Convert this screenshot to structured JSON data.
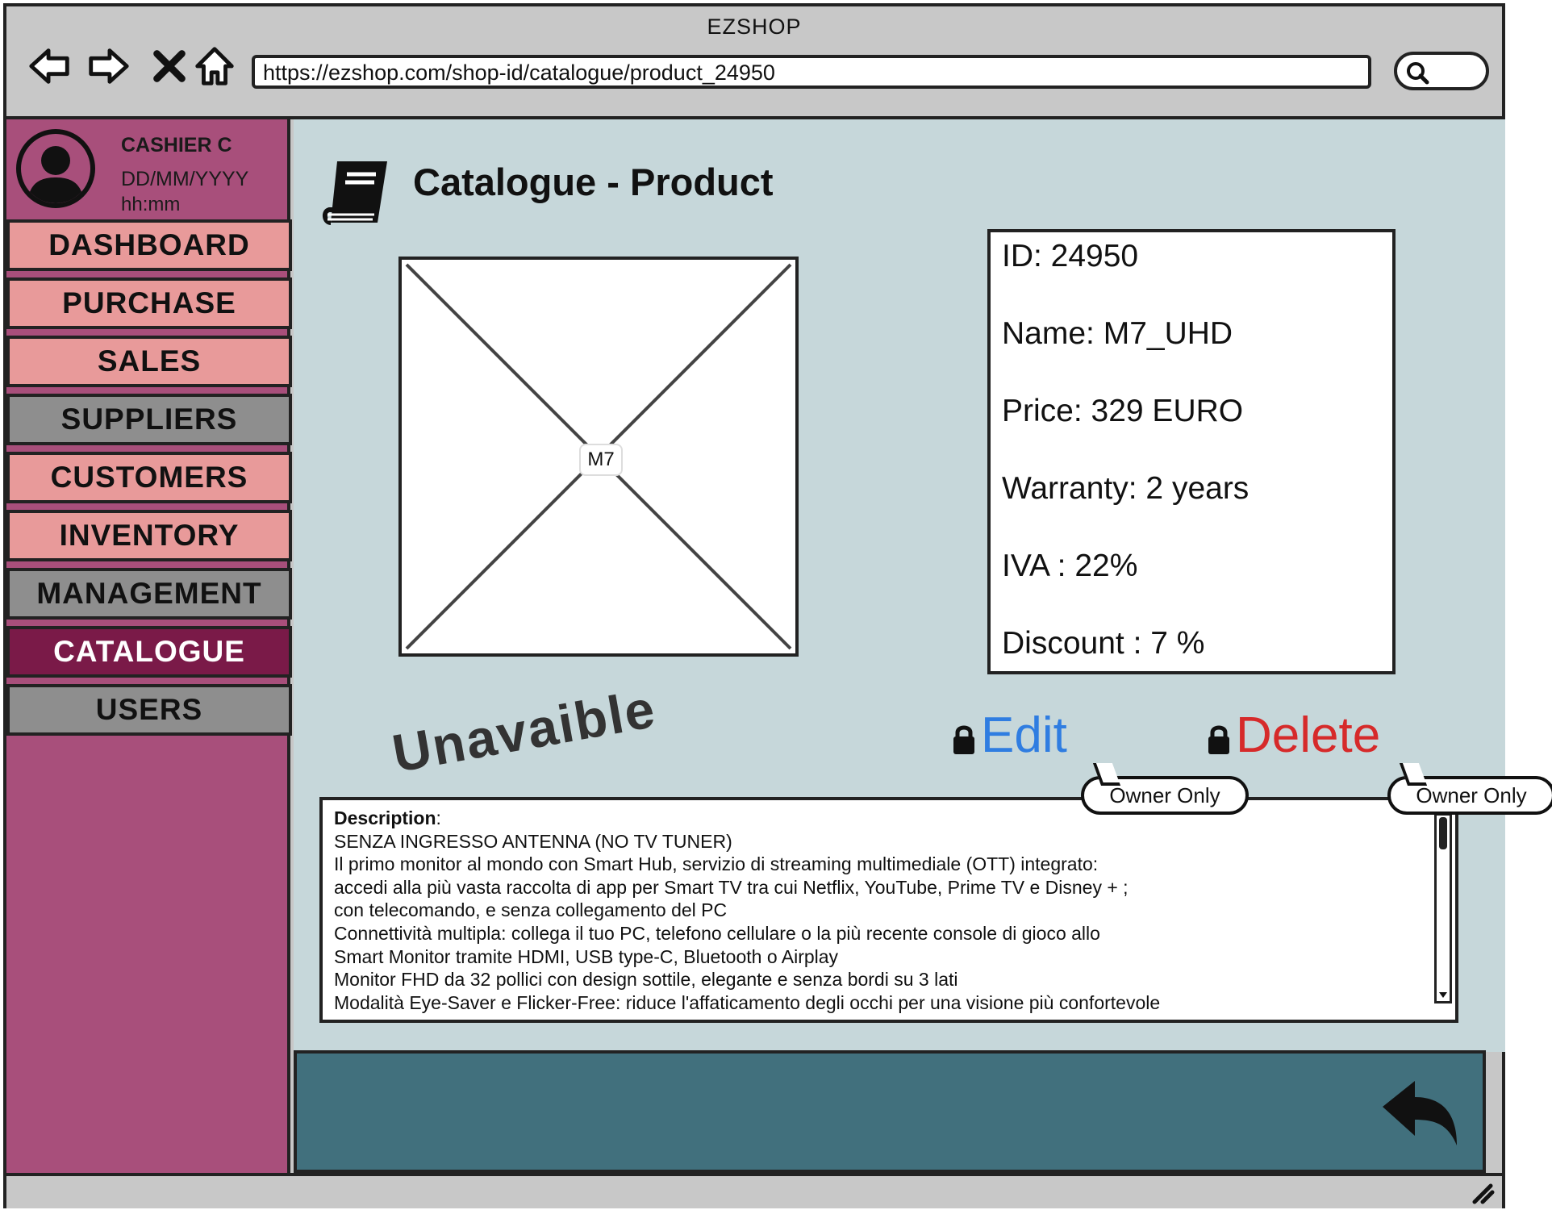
{
  "window": {
    "title": "EZSHOP"
  },
  "browser": {
    "url": "https://ezshop.com/shop-id/catalogue/product_24950"
  },
  "user": {
    "name": "CASHIER C",
    "date": "DD/MM/YYYY",
    "time": "hh:mm"
  },
  "menu": [
    {
      "label": "DASHBOARD",
      "state": "pink"
    },
    {
      "label": "PURCHASE",
      "state": "pink"
    },
    {
      "label": "SALES",
      "state": "pink"
    },
    {
      "label": "SUPPLIERS",
      "state": "gray"
    },
    {
      "label": "CUSTOMERS",
      "state": "pink"
    },
    {
      "label": "INVENTORY",
      "state": "pink"
    },
    {
      "label": "MANAGEMENT",
      "state": "gray"
    },
    {
      "label": "CATALOGUE",
      "state": "active"
    },
    {
      "label": "USERS",
      "state": "gray"
    }
  ],
  "page": {
    "title": "Catalogue - Product",
    "image_placeholder_label": "M7",
    "status_label": "Unavaible"
  },
  "product": {
    "id": "ID: 24950",
    "name": "Name: M7_UHD",
    "price": "Price: 329 EURO",
    "warranty": "Warranty: 2 years",
    "iva": "IVA : 22%",
    "discount": "Discount : 7 %"
  },
  "actions": {
    "edit_label": "Edit",
    "delete_label": "Delete",
    "edit_tooltip": "Owner Only",
    "delete_tooltip": "Owner Only"
  },
  "description": {
    "heading": "Description",
    "heading_suffix": ":",
    "lines": [
      "SENZA INGRESSO ANTENNA (NO TV TUNER)",
      "Il primo monitor al mondo con Smart Hub, servizio di streaming multimediale (OTT) integrato:",
      "accedi alla più vasta raccolta di app per Smart TV tra cui Netflix, YouTube, Prime TV e Disney + ;",
      " con telecomando, e senza collegamento del PC",
      "Connettività multipla: collega il tuo PC, telefono cellulare o la più recente console di gioco allo",
      "Smart Monitor tramite HDMI, USB type-C, Bluetooth o Airplay",
      "Monitor FHD da 32 pollici con design sottile, elegante e senza bordi su 3 lati",
      "Modalità Eye-Saver e Flicker-Free: riduce l'affaticamento degli occhi per una visione più confortevole"
    ]
  },
  "colors": {
    "sidebar": "#a84f7b",
    "menu_pink": "#e89a9a",
    "menu_gray": "#8e8e8e",
    "menu_active": "#7a1a48",
    "content_bg": "#c6d7da",
    "footer": "#41707d",
    "edit": "#2f7de1",
    "delete": "#d62a2a"
  },
  "icons": {
    "back": "arrow-left-icon",
    "forward": "arrow-right-icon",
    "close": "close-icon",
    "home": "home-icon",
    "search": "search-icon",
    "catalogue": "book-icon",
    "lock": "lock-icon",
    "return": "undo-arrow-icon",
    "resize": "resize-grip-icon"
  }
}
